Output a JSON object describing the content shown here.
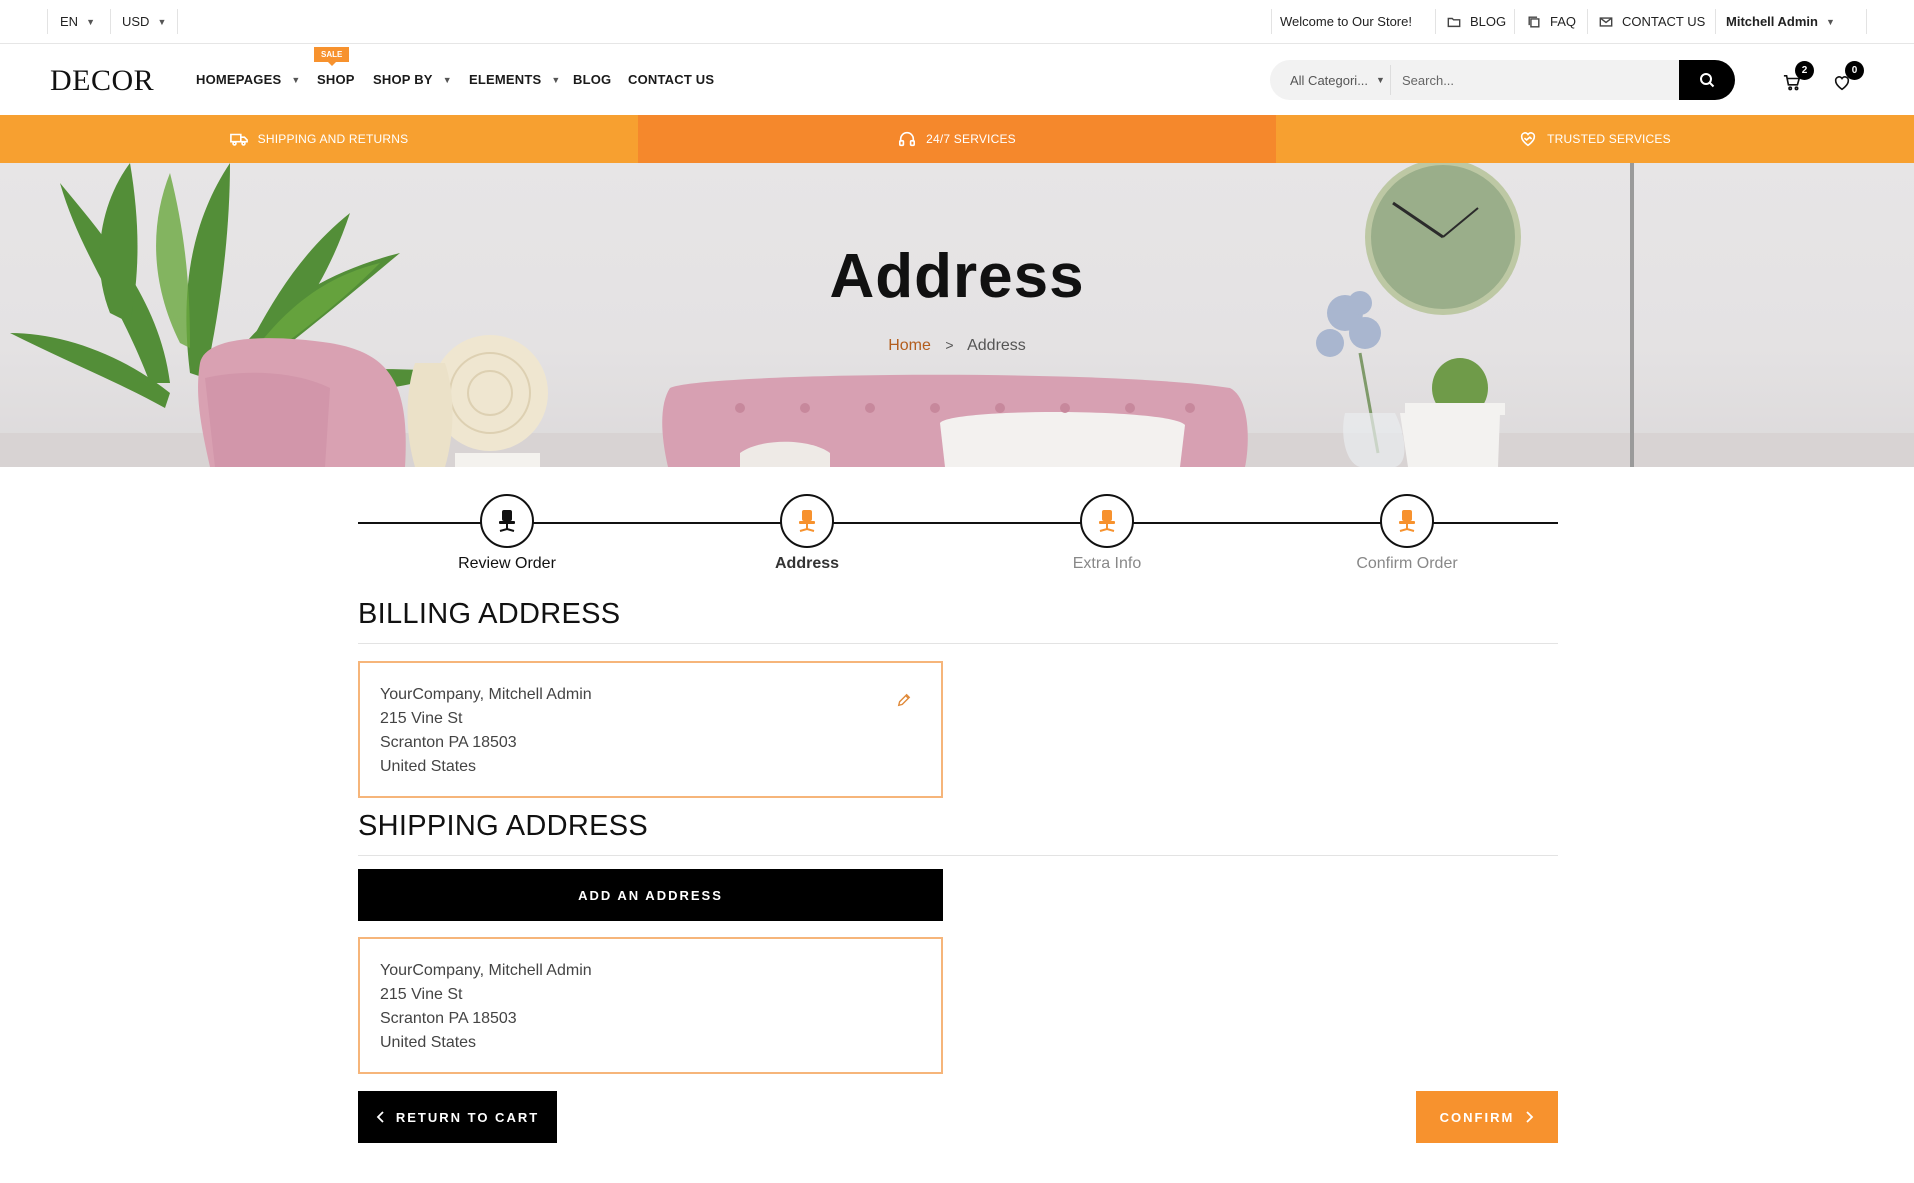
{
  "topbar": {
    "language": "EN",
    "currency": "USD",
    "welcome": "Welcome to Our Store!",
    "links": [
      {
        "label": "BLOG",
        "icon": "folder-icon"
      },
      {
        "label": "FAQ",
        "icon": "copy-icon"
      },
      {
        "label": "CONTACT US",
        "icon": "mail-icon"
      }
    ],
    "user": "Mitchell Admin"
  },
  "header": {
    "logo": "DECOR",
    "nav": [
      {
        "label": "HOMEPAGES",
        "dropdown": true
      },
      {
        "label": "SHOP",
        "dropdown": false,
        "badge": "SALE"
      },
      {
        "label": "SHOP BY",
        "dropdown": true
      },
      {
        "label": "ELEMENTS",
        "dropdown": true
      },
      {
        "label": "BLOG",
        "dropdown": false
      },
      {
        "label": "CONTACT US",
        "dropdown": false
      }
    ],
    "search": {
      "category": "All Categori...",
      "placeholder": "Search..."
    },
    "cart_count": "2",
    "wishlist_count": "0"
  },
  "service_bar": {
    "items": [
      {
        "label": "SHIPPING AND RETURNS",
        "icon": "truck-icon",
        "color": "#f7a030"
      },
      {
        "label": "24/7 SERVICES",
        "icon": "headphones-icon",
        "color": "#f5882c"
      },
      {
        "label": "TRUSTED SERVICES",
        "icon": "heart-handshake-icon",
        "color": "#f7a030"
      }
    ]
  },
  "hero": {
    "title": "Address",
    "breadcrumb": {
      "home": "Home",
      "separator": ">",
      "current": "Address"
    }
  },
  "steps": [
    {
      "label": "Review Order",
      "state": "done"
    },
    {
      "label": "Address",
      "state": "current"
    },
    {
      "label": "Extra Info",
      "state": "pending"
    },
    {
      "label": "Confirm Order",
      "state": "pending"
    }
  ],
  "billing": {
    "title": "BILLING ADDRESS",
    "lines": [
      "YourCompany, Mitchell Admin",
      "215 Vine St",
      "Scranton PA 18503",
      "United States"
    ]
  },
  "shipping": {
    "title": "SHIPPING ADDRESS",
    "add_label": "ADD AN ADDRESS",
    "lines": [
      "YourCompany, Mitchell Admin",
      "215 Vine St",
      "Scranton PA 18503",
      "United States"
    ]
  },
  "actions": {
    "return_label": "RETURN TO CART",
    "confirm_label": "CONFIRM"
  },
  "colors": {
    "accent": "#f7922e",
    "accent_dark": "#b35d1c",
    "card_border": "#f6b57a"
  }
}
